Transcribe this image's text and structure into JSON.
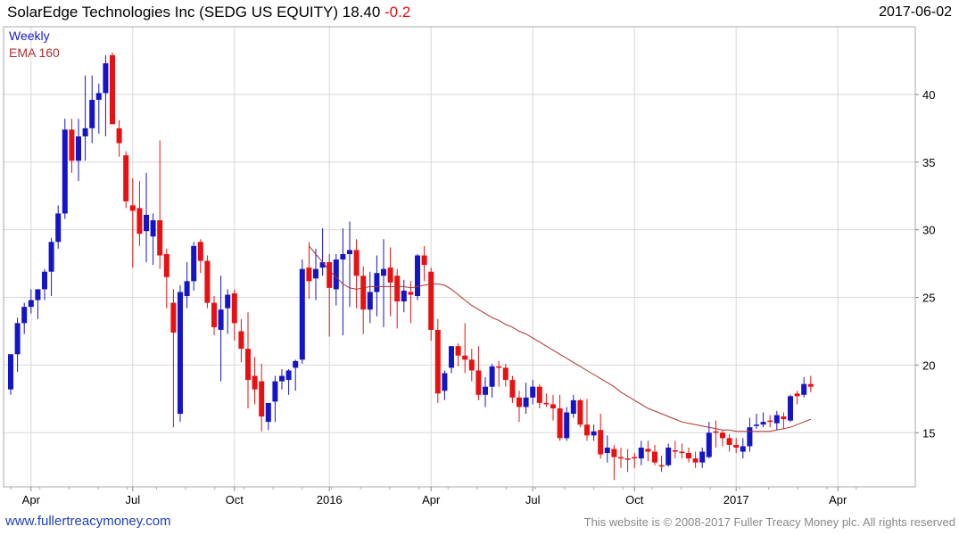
{
  "header": {
    "title": "SolarEdge Technologies Inc (SEDG US EQUITY) 18.40",
    "change": "-0.2",
    "date": "2017-06-02"
  },
  "legend": {
    "weekly": "Weekly",
    "ema": "EMA 160"
  },
  "footer": {
    "url": "www.fullertreacymoney.com",
    "copyright": "This website is © 2008-2017 Fuller Treacy Money plc. All rights reserved"
  },
  "colors": {
    "up": "#1515c8",
    "down": "#e81010",
    "ema": "#b03030",
    "grid": "#d8d8d8"
  },
  "chart_data": {
    "type": "candlestick",
    "frequency": "weekly",
    "ylim": [
      11,
      45
    ],
    "y_ticks": [
      15,
      20,
      25,
      30,
      35,
      40
    ],
    "x_tick_labels": [
      "Apr",
      "Jul",
      "Oct",
      "2016",
      "Apr",
      "Jul",
      "Oct",
      "2017",
      "Apr"
    ],
    "grid": true,
    "series": [
      {
        "name": "Weekly",
        "ohlc": [
          [
            18.2,
            20.8,
            17.8,
            20.8
          ],
          [
            20.8,
            23.5,
            19.5,
            23.1
          ],
          [
            23.1,
            24.6,
            22.3,
            24.3
          ],
          [
            24.3,
            25.6,
            23.8,
            24.8
          ],
          [
            24.8,
            25.6,
            23.4,
            25.6
          ],
          [
            25.6,
            27.1,
            24.8,
            26.9
          ],
          [
            26.9,
            29.4,
            25.1,
            29.1
          ],
          [
            29.1,
            31.8,
            28.6,
            31.2
          ],
          [
            31.2,
            38.2,
            30.8,
            37.4
          ],
          [
            37.4,
            38.2,
            34.2,
            35.1
          ],
          [
            35.1,
            38.2,
            33.6,
            36.9
          ],
          [
            36.9,
            41.4,
            35.1,
            37.5
          ],
          [
            37.5,
            41.4,
            36.4,
            39.6
          ],
          [
            39.6,
            40.8,
            37.1,
            40.1
          ],
          [
            40.1,
            42.9,
            36.9,
            42.3
          ],
          [
            42.9,
            43.1,
            37.8,
            37.8
          ],
          [
            37.5,
            38.1,
            35.4,
            36.4
          ],
          [
            35.5,
            35.8,
            31.6,
            32.1
          ],
          [
            31.8,
            33.8,
            27.2,
            31.4
          ],
          [
            31.6,
            33.6,
            28.8,
            29.7
          ],
          [
            29.9,
            34.2,
            27.6,
            31.1
          ],
          [
            29.5,
            31.2,
            27.4,
            30.7
          ],
          [
            30.7,
            36.6,
            27.1,
            28.1
          ],
          [
            28.2,
            28.6,
            24.2,
            26.5
          ],
          [
            24.6,
            25.6,
            15.4,
            22.4
          ],
          [
            16.4,
            25.9,
            15.8,
            25.4
          ],
          [
            25.1,
            27.6,
            24.2,
            26.2
          ],
          [
            26.2,
            29.1,
            25.5,
            28.8
          ],
          [
            29.1,
            29.3,
            26.8,
            27.7
          ],
          [
            27.7,
            28.1,
            24.2,
            24.6
          ],
          [
            24.6,
            25.1,
            22.2,
            22.8
          ],
          [
            22.6,
            26.6,
            18.8,
            24.1
          ],
          [
            24.2,
            25.6,
            22.3,
            25.2
          ],
          [
            25.3,
            25.6,
            21.8,
            23.1
          ],
          [
            22.5,
            23.4,
            20.2,
            21.2
          ],
          [
            21.2,
            23.9,
            16.8,
            18.9
          ],
          [
            19.2,
            20.6,
            17.1,
            18.2
          ],
          [
            18.8,
            20.1,
            15.1,
            16.2
          ],
          [
            15.8,
            17.1,
            15.2,
            17.2
          ],
          [
            17.3,
            19.2,
            15.8,
            18.8
          ],
          [
            18.8,
            19.7,
            18.2,
            19.2
          ],
          [
            18.9,
            19.7,
            17.8,
            19.6
          ],
          [
            19.8,
            20.4,
            18.1,
            20.3
          ],
          [
            20.4,
            27.8,
            20.1,
            27.1
          ],
          [
            27.2,
            29.1,
            24.9,
            26.2
          ],
          [
            26.4,
            28.6,
            24.8,
            27.1
          ],
          [
            27.2,
            30.1,
            26.6,
            27.6
          ],
          [
            27.6,
            28.2,
            22.1,
            25.7
          ],
          [
            25.6,
            28.2,
            24.4,
            27.8
          ],
          [
            27.8,
            30.1,
            22.2,
            28.2
          ],
          [
            28.2,
            30.6,
            24.3,
            28.5
          ],
          [
            28.5,
            29.3,
            24.2,
            26.6
          ],
          [
            26.6,
            27.3,
            22.3,
            24.1
          ],
          [
            24.1,
            26.9,
            23.1,
            25.4
          ],
          [
            25.4,
            28.1,
            23.6,
            26.8
          ],
          [
            26.6,
            29.3,
            22.8,
            27.1
          ],
          [
            27.2,
            28.7,
            23.6,
            26.1
          ],
          [
            26.6,
            27.1,
            22.7,
            24.7
          ],
          [
            24.7,
            26.3,
            23.9,
            25.5
          ],
          [
            25.4,
            26.2,
            23.1,
            25.2
          ],
          [
            25.1,
            28.2,
            24.8,
            28.1
          ],
          [
            28.1,
            28.8,
            26.2,
            27.4
          ],
          [
            26.9,
            27.2,
            21.8,
            22.6
          ],
          [
            22.6,
            23.4,
            17.2,
            17.9
          ],
          [
            18.1,
            19.6,
            17.4,
            19.4
          ],
          [
            19.8,
            21.4,
            19.4,
            21.4
          ],
          [
            21.4,
            21.6,
            19.9,
            20.7
          ],
          [
            20.7,
            23.1,
            19.4,
            20.4
          ],
          [
            20.4,
            21.2,
            18.8,
            19.6
          ],
          [
            19.6,
            21.4,
            17.4,
            17.8
          ],
          [
            17.8,
            19.1,
            16.9,
            18.4
          ],
          [
            18.4,
            20.1,
            17.6,
            19.9
          ],
          [
            19.9,
            20.3,
            18.4,
            19.8
          ],
          [
            19.8,
            20.1,
            18.4,
            18.9
          ],
          [
            18.9,
            19.2,
            17.2,
            17.6
          ],
          [
            17.6,
            18.1,
            15.8,
            16.9
          ],
          [
            16.9,
            18.7,
            16.4,
            17.6
          ],
          [
            17.6,
            18.9,
            17.1,
            18.4
          ],
          [
            18.4,
            18.6,
            16.8,
            17.2
          ],
          [
            17.2,
            17.9,
            16.9,
            17.1
          ],
          [
            17.1,
            17.8,
            15.9,
            16.8
          ],
          [
            16.8,
            17.8,
            14.4,
            14.6
          ],
          [
            14.6,
            16.9,
            14.4,
            16.5
          ],
          [
            16.4,
            17.8,
            16.1,
            17.4
          ],
          [
            17.4,
            17.5,
            15.4,
            15.6
          ],
          [
            15.6,
            17.5,
            14.4,
            14.8
          ],
          [
            14.8,
            15.6,
            14.4,
            15.1
          ],
          [
            15.2,
            16.4,
            13.1,
            13.4
          ],
          [
            13.5,
            14.8,
            12.8,
            13.9
          ],
          [
            13.8,
            14.1,
            11.5,
            13.2
          ],
          [
            13.2,
            13.9,
            12.4,
            13.1
          ],
          [
            13.1,
            13.8,
            12.1,
            13.0
          ],
          [
            13.2,
            13.5,
            12.4,
            13.1
          ],
          [
            13.1,
            14.4,
            12.6,
            13.9
          ],
          [
            13.8,
            14.4,
            12.9,
            13.6
          ],
          [
            13.6,
            14.1,
            12.6,
            12.8
          ],
          [
            12.6,
            13.3,
            12.1,
            12.5
          ],
          [
            12.6,
            14.2,
            12.5,
            13.9
          ],
          [
            13.7,
            14.4,
            13.1,
            13.6
          ],
          [
            13.6,
            14.2,
            13.1,
            13.5
          ],
          [
            13.5,
            13.9,
            12.8,
            13.1
          ],
          [
            13.1,
            13.6,
            12.4,
            12.8
          ],
          [
            12.8,
            13.9,
            12.4,
            13.6
          ],
          [
            13.2,
            15.8,
            13.1,
            15.0
          ],
          [
            15.1,
            15.9,
            13.9,
            15.0
          ],
          [
            15.0,
            15.2,
            14.0,
            14.6
          ],
          [
            14.6,
            14.9,
            13.6,
            14.1
          ],
          [
            14.1,
            14.6,
            13.5,
            13.9
          ],
          [
            13.6,
            14.6,
            13.1,
            14.0
          ],
          [
            14.0,
            16.1,
            13.6,
            15.4
          ],
          [
            15.5,
            16.4,
            15.3,
            15.6
          ],
          [
            15.6,
            16.5,
            15.4,
            15.8
          ],
          [
            15.9,
            16.3,
            15.4,
            15.8
          ],
          [
            15.7,
            16.6,
            15.2,
            16.3
          ],
          [
            16.2,
            16.5,
            15.3,
            16.0
          ],
          [
            15.9,
            17.8,
            15.8,
            17.7
          ],
          [
            17.9,
            18.1,
            17.1,
            17.7
          ],
          [
            17.8,
            19.1,
            17.6,
            18.6
          ],
          [
            18.6,
            19.2,
            18.0,
            18.4
          ]
        ]
      },
      {
        "name": "EMA 160",
        "start_index": 44,
        "values": [
          28.8,
          28.2,
          27.6,
          27.0,
          26.5,
          26.0,
          25.7,
          25.6,
          25.7,
          25.8,
          25.8,
          25.8,
          25.8,
          25.8,
          25.8,
          25.7,
          25.8,
          25.9,
          26.0,
          26.0,
          25.9,
          25.6,
          25.2,
          24.8,
          24.4,
          24.1,
          23.8,
          23.5,
          23.3,
          23.0,
          22.8,
          22.5,
          22.3,
          22.0,
          21.7,
          21.4,
          21.1,
          20.8,
          20.5,
          20.2,
          19.9,
          19.6,
          19.3,
          19.0,
          18.7,
          18.4,
          18.0,
          17.7,
          17.4,
          17.1,
          16.8,
          16.6,
          16.4,
          16.2,
          16.0,
          15.8,
          15.7,
          15.6,
          15.5,
          15.4,
          15.3,
          15.2,
          15.2,
          15.1,
          15.1,
          15.1,
          15.1,
          15.1,
          15.1,
          15.2,
          15.3,
          15.4,
          15.6,
          15.8,
          16.0
        ]
      }
    ]
  }
}
